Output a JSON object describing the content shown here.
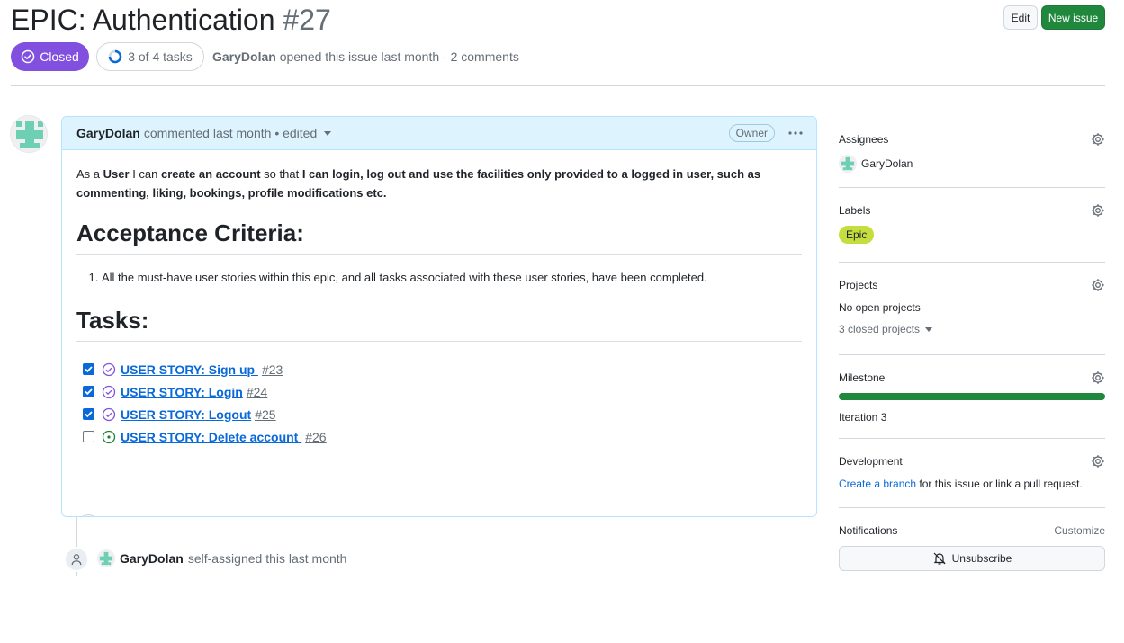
{
  "issue": {
    "title": "EPIC: Authentication",
    "number": "#27",
    "state": "Closed",
    "tasks_progress": "3 of 4 tasks",
    "author": "GaryDolan",
    "meta_rest": "opened this issue last month · 2 comments"
  },
  "header_buttons": {
    "edit": "Edit",
    "new_issue": "New issue"
  },
  "comment": {
    "author": "GaryDolan",
    "meta": "commented last month • edited",
    "badge": "Owner",
    "body": {
      "p1": "As a",
      "p2": "User",
      "p3": "I can",
      "p4": "create an account",
      "p5": "so that",
      "p6": "I can login, log out and use the facilities only provided to a logged in user, such as commenting, liking, bookings, profile modifications etc.",
      "heading1": "Acceptance Criteria:",
      "criteria": [
        "All the must-have user stories within this epic, and all tasks associated with these user stories, have been completed."
      ],
      "heading2": "Tasks:",
      "tasks": [
        {
          "title": "USER STORY: Sign up ",
          "number": "#23",
          "checked": true,
          "state": "closed"
        },
        {
          "title": "USER STORY: Login",
          "number": "#24",
          "checked": true,
          "state": "closed"
        },
        {
          "title": "USER STORY: Logout",
          "number": "#25",
          "checked": true,
          "state": "closed"
        },
        {
          "title": "USER STORY: Delete account ",
          "number": "#26",
          "checked": false,
          "state": "open"
        }
      ]
    }
  },
  "timeline": {
    "actor": "GaryDolan",
    "action": "self-assigned this last month"
  },
  "sidebar": {
    "assignees": {
      "label": "Assignees",
      "value": "GaryDolan"
    },
    "labels": {
      "label": "Labels",
      "value": "Epic",
      "color": "#c5de3d"
    },
    "projects": {
      "label": "Projects",
      "value": "No open projects",
      "closed": "3 closed projects"
    },
    "milestone": {
      "label": "Milestone",
      "value": "Iteration 3",
      "progress": 1.0
    },
    "development": {
      "label": "Development",
      "link": "Create a branch",
      "rest": "for this issue or link a pull request."
    },
    "notifications": {
      "label": "Notifications",
      "customize": "Customize",
      "button": "Unsubscribe"
    }
  },
  "colors": {
    "closed_purple": "#8250df",
    "green": "#1f883d",
    "link_blue": "#0969da"
  }
}
